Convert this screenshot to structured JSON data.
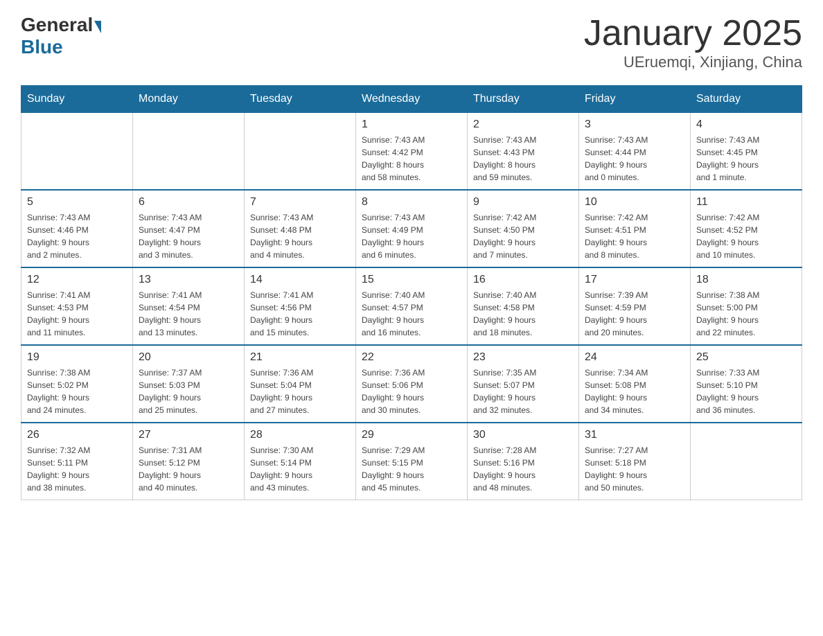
{
  "header": {
    "logo_general": "General",
    "logo_blue": "Blue",
    "month_title": "January 2025",
    "location": "UEruemqi, Xinjiang, China"
  },
  "days_of_week": [
    "Sunday",
    "Monday",
    "Tuesday",
    "Wednesday",
    "Thursday",
    "Friday",
    "Saturday"
  ],
  "weeks": [
    [
      {
        "day": "",
        "info": ""
      },
      {
        "day": "",
        "info": ""
      },
      {
        "day": "",
        "info": ""
      },
      {
        "day": "1",
        "info": "Sunrise: 7:43 AM\nSunset: 4:42 PM\nDaylight: 8 hours\nand 58 minutes."
      },
      {
        "day": "2",
        "info": "Sunrise: 7:43 AM\nSunset: 4:43 PM\nDaylight: 8 hours\nand 59 minutes."
      },
      {
        "day": "3",
        "info": "Sunrise: 7:43 AM\nSunset: 4:44 PM\nDaylight: 9 hours\nand 0 minutes."
      },
      {
        "day": "4",
        "info": "Sunrise: 7:43 AM\nSunset: 4:45 PM\nDaylight: 9 hours\nand 1 minute."
      }
    ],
    [
      {
        "day": "5",
        "info": "Sunrise: 7:43 AM\nSunset: 4:46 PM\nDaylight: 9 hours\nand 2 minutes."
      },
      {
        "day": "6",
        "info": "Sunrise: 7:43 AM\nSunset: 4:47 PM\nDaylight: 9 hours\nand 3 minutes."
      },
      {
        "day": "7",
        "info": "Sunrise: 7:43 AM\nSunset: 4:48 PM\nDaylight: 9 hours\nand 4 minutes."
      },
      {
        "day": "8",
        "info": "Sunrise: 7:43 AM\nSunset: 4:49 PM\nDaylight: 9 hours\nand 6 minutes."
      },
      {
        "day": "9",
        "info": "Sunrise: 7:42 AM\nSunset: 4:50 PM\nDaylight: 9 hours\nand 7 minutes."
      },
      {
        "day": "10",
        "info": "Sunrise: 7:42 AM\nSunset: 4:51 PM\nDaylight: 9 hours\nand 8 minutes."
      },
      {
        "day": "11",
        "info": "Sunrise: 7:42 AM\nSunset: 4:52 PM\nDaylight: 9 hours\nand 10 minutes."
      }
    ],
    [
      {
        "day": "12",
        "info": "Sunrise: 7:41 AM\nSunset: 4:53 PM\nDaylight: 9 hours\nand 11 minutes."
      },
      {
        "day": "13",
        "info": "Sunrise: 7:41 AM\nSunset: 4:54 PM\nDaylight: 9 hours\nand 13 minutes."
      },
      {
        "day": "14",
        "info": "Sunrise: 7:41 AM\nSunset: 4:56 PM\nDaylight: 9 hours\nand 15 minutes."
      },
      {
        "day": "15",
        "info": "Sunrise: 7:40 AM\nSunset: 4:57 PM\nDaylight: 9 hours\nand 16 minutes."
      },
      {
        "day": "16",
        "info": "Sunrise: 7:40 AM\nSunset: 4:58 PM\nDaylight: 9 hours\nand 18 minutes."
      },
      {
        "day": "17",
        "info": "Sunrise: 7:39 AM\nSunset: 4:59 PM\nDaylight: 9 hours\nand 20 minutes."
      },
      {
        "day": "18",
        "info": "Sunrise: 7:38 AM\nSunset: 5:00 PM\nDaylight: 9 hours\nand 22 minutes."
      }
    ],
    [
      {
        "day": "19",
        "info": "Sunrise: 7:38 AM\nSunset: 5:02 PM\nDaylight: 9 hours\nand 24 minutes."
      },
      {
        "day": "20",
        "info": "Sunrise: 7:37 AM\nSunset: 5:03 PM\nDaylight: 9 hours\nand 25 minutes."
      },
      {
        "day": "21",
        "info": "Sunrise: 7:36 AM\nSunset: 5:04 PM\nDaylight: 9 hours\nand 27 minutes."
      },
      {
        "day": "22",
        "info": "Sunrise: 7:36 AM\nSunset: 5:06 PM\nDaylight: 9 hours\nand 30 minutes."
      },
      {
        "day": "23",
        "info": "Sunrise: 7:35 AM\nSunset: 5:07 PM\nDaylight: 9 hours\nand 32 minutes."
      },
      {
        "day": "24",
        "info": "Sunrise: 7:34 AM\nSunset: 5:08 PM\nDaylight: 9 hours\nand 34 minutes."
      },
      {
        "day": "25",
        "info": "Sunrise: 7:33 AM\nSunset: 5:10 PM\nDaylight: 9 hours\nand 36 minutes."
      }
    ],
    [
      {
        "day": "26",
        "info": "Sunrise: 7:32 AM\nSunset: 5:11 PM\nDaylight: 9 hours\nand 38 minutes."
      },
      {
        "day": "27",
        "info": "Sunrise: 7:31 AM\nSunset: 5:12 PM\nDaylight: 9 hours\nand 40 minutes."
      },
      {
        "day": "28",
        "info": "Sunrise: 7:30 AM\nSunset: 5:14 PM\nDaylight: 9 hours\nand 43 minutes."
      },
      {
        "day": "29",
        "info": "Sunrise: 7:29 AM\nSunset: 5:15 PM\nDaylight: 9 hours\nand 45 minutes."
      },
      {
        "day": "30",
        "info": "Sunrise: 7:28 AM\nSunset: 5:16 PM\nDaylight: 9 hours\nand 48 minutes."
      },
      {
        "day": "31",
        "info": "Sunrise: 7:27 AM\nSunset: 5:18 PM\nDaylight: 9 hours\nand 50 minutes."
      },
      {
        "day": "",
        "info": ""
      }
    ]
  ]
}
